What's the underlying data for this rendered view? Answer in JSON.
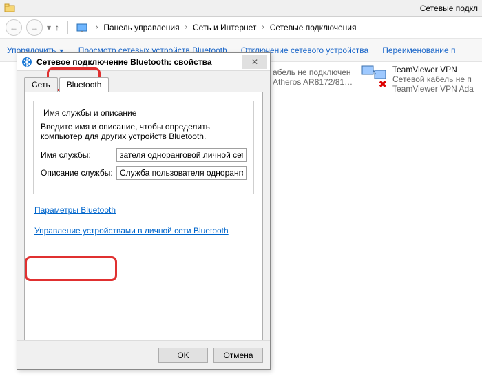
{
  "window": {
    "title_right": "Сетевые подкл"
  },
  "breadcrumb": {
    "root": "Панель управления",
    "mid": "Сеть и Интернет",
    "leaf": "Сетевые подключения"
  },
  "toolbar": {
    "organize": "Упорядочить",
    "view_bt": "Просмотр сетевых устройств Bluetooth",
    "disable": "Отключение сетевого устройства",
    "rename": "Переименование п"
  },
  "bg_left": {
    "line1": "абель не подключен",
    "line2": "Atheros AR8172/81…"
  },
  "bg_right": {
    "title": "TeamViewer VPN",
    "line1": "Сетевой кабель не п",
    "line2": "TeamViewer VPN Ada"
  },
  "dialog": {
    "caption": "Сетевое подключение Bluetooth: свойства",
    "tabs": {
      "network": "Сеть",
      "bluetooth": "Bluetooth"
    },
    "group": {
      "header": "Имя службы и описание",
      "desc": "Введите имя и описание, чтобы определить компьютер для других устройств Bluetooth.",
      "name_label": "Имя службы:",
      "name_value": "зателя одноранговой личной сети",
      "desc_label": "Описание службы:",
      "desc_value": "Служба пользователя одноранговой"
    },
    "link_params": "Параметры Bluetooth",
    "link_manage": "Управление устройствами в личной сети Bluetooth",
    "ok": "OK",
    "cancel": "Отмена"
  }
}
